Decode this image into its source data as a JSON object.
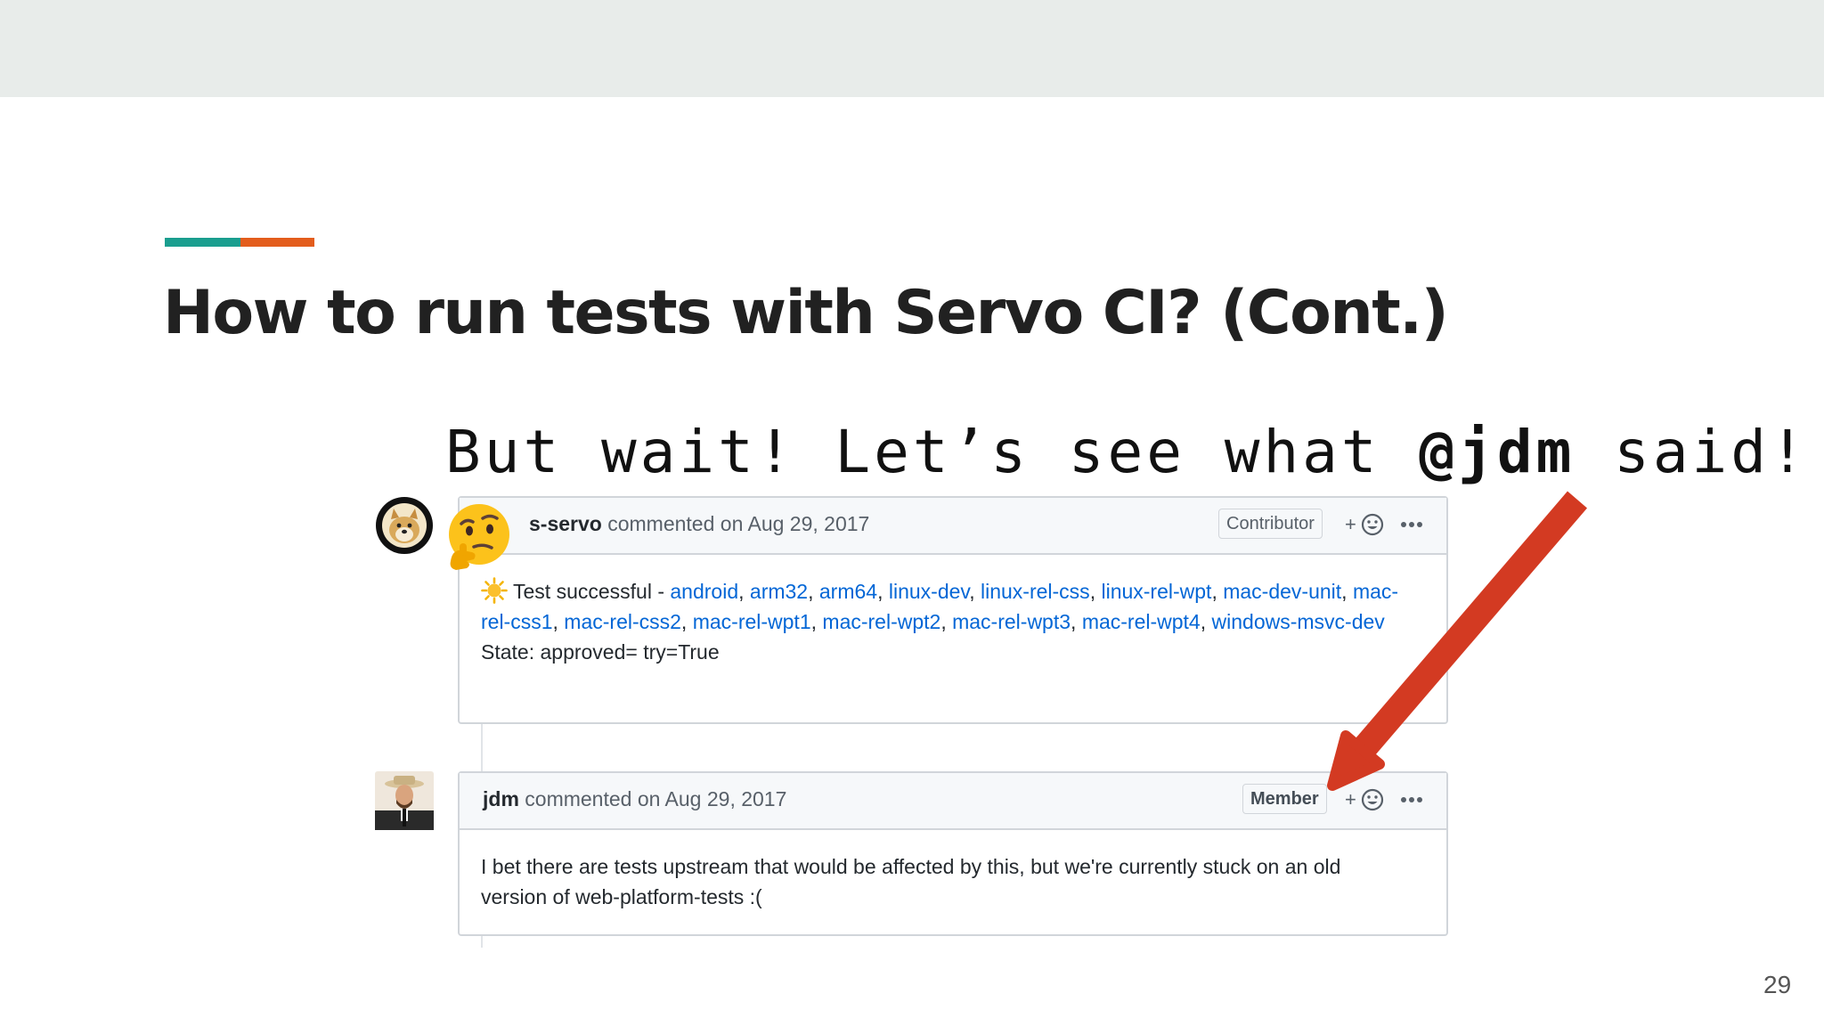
{
  "slide": {
    "title": "How to run tests with Servo CI? (Cont.)",
    "page_number": "29",
    "colors": {
      "accent_teal": "#1a9e8f",
      "accent_orange": "#e35d1c",
      "arrow": "#d33a22",
      "link": "#0366d6"
    }
  },
  "callout": {
    "prefix": "But wait! Let’s see what ",
    "mention": "@jdm",
    "suffix": " said!"
  },
  "comments": [
    {
      "avatar_icon": "doge-avatar-icon",
      "overlay_icon": "thinking-face-emoji-icon",
      "author": "s-servo",
      "meta": "commented on Aug 29, 2017",
      "badge": "Contributor",
      "reaction_label": "+",
      "status_icon": "sun-emoji-icon",
      "status_text": "Test successful - ",
      "builders": [
        "android",
        "arm32",
        "arm64",
        "linux-dev",
        "linux-rel-css",
        "linux-rel-wpt",
        "mac-dev-unit",
        "mac-rel-css1",
        "mac-rel-css2",
        "mac-rel-wpt1",
        "mac-rel-wpt2",
        "mac-rel-wpt3",
        "mac-rel-wpt4",
        "windows-msvc-dev"
      ],
      "state": "State: approved= try=True"
    },
    {
      "avatar_icon": "jdm-avatar-icon",
      "author": "jdm",
      "meta": "commented on Aug 29, 2017",
      "badge": "Member",
      "reaction_label": "+",
      "body_line1": "I bet there are tests upstream that would be affected by this, but we're currently stuck on an old",
      "body_line2": "version of web-platform-tests :("
    }
  ]
}
